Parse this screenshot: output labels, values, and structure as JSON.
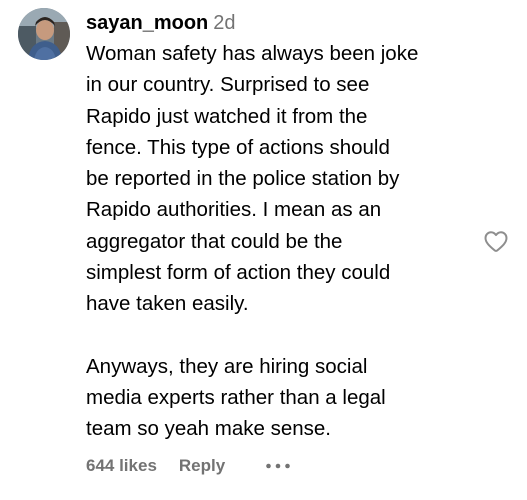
{
  "comment": {
    "username": "sayan_moon",
    "timestamp": "2d",
    "paragraph_1": "Woman safety has always been joke\nin our country. Surprised to see\nRapido just watched it from the\nfence. This type of actions should\nbe reported in the police station by\nRapido authorities. I mean as an\naggregator that could be the\nsimplest form of action they could\nhave taken easily.",
    "paragraph_2": "Anyways, they are hiring social\nmedia experts rather than a legal\nteam so yeah make sense."
  },
  "actions": {
    "likes": "644 likes",
    "reply": "Reply"
  },
  "icons": {
    "avatar": "user-avatar",
    "like": "heart-outline-icon",
    "more": "more-horizontal-icon"
  },
  "colors": {
    "text": "#000000",
    "muted": "#737373",
    "icon": "#8e8e8e"
  }
}
